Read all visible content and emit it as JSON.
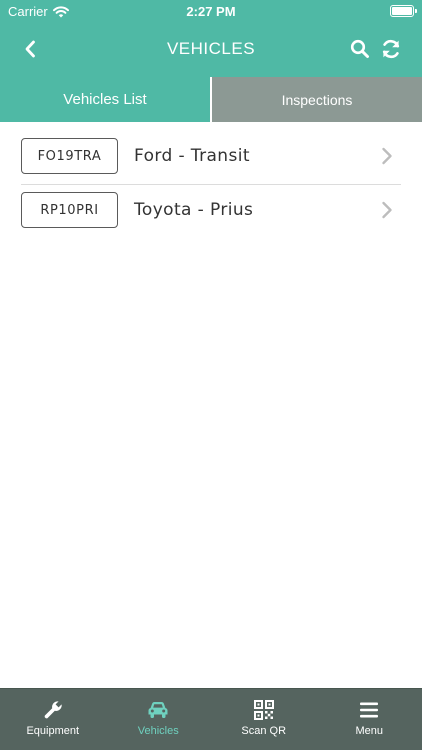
{
  "status_bar": {
    "carrier": "Carrier",
    "time": "2:27 PM"
  },
  "header": {
    "title": "VEHICLES"
  },
  "tabs": [
    {
      "label": "Vehicles List",
      "active": true
    },
    {
      "label": "Inspections",
      "active": false
    }
  ],
  "vehicles": [
    {
      "plate": "FO19TRA",
      "name": "Ford - Transit"
    },
    {
      "plate": "RP10PRI",
      "name": "Toyota - Prius"
    }
  ],
  "bottom_nav": [
    {
      "label": "Equipment",
      "icon": "wrench-icon",
      "selected": false
    },
    {
      "label": "Vehicles",
      "icon": "car-icon",
      "selected": true
    },
    {
      "label": "Scan QR",
      "icon": "qr-code-icon",
      "selected": false
    },
    {
      "label": "Menu",
      "icon": "hamburger-menu-icon",
      "selected": false
    }
  ],
  "colors": {
    "primary": "#4fb9a5",
    "inactive_tab": "#8c9994",
    "bottom_bar": "#55645f",
    "selected_nav": "#6fd1bf"
  }
}
